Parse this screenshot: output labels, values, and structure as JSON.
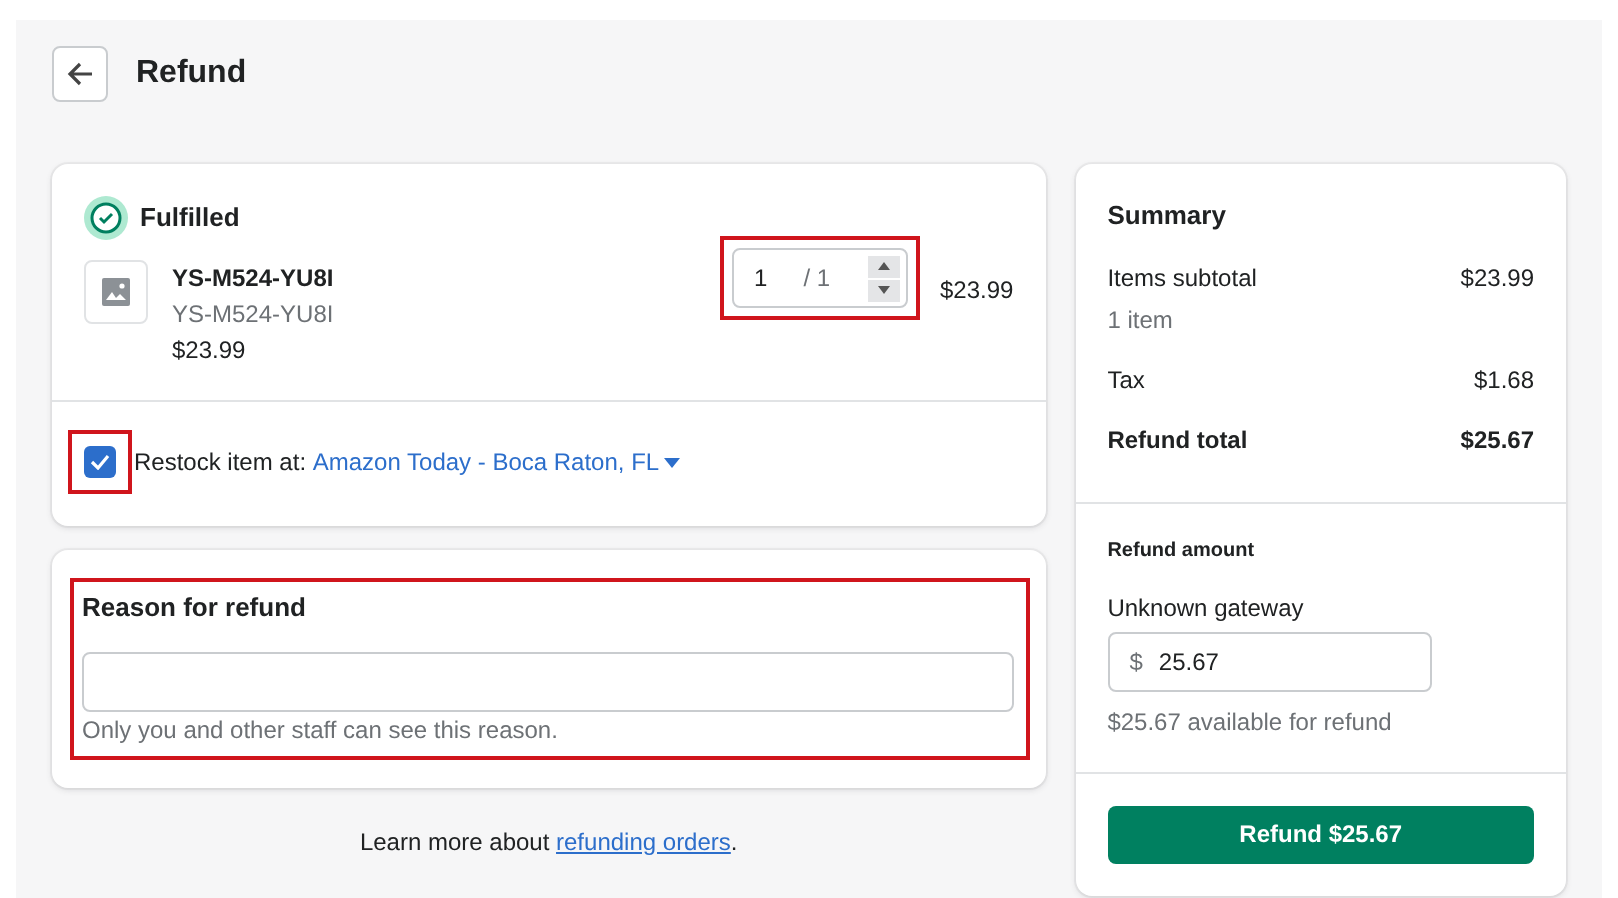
{
  "header": {
    "title": "Refund"
  },
  "fulfillment": {
    "status": "Fulfilled",
    "item": {
      "title": "YS-M524-YU8I",
      "sku": "YS-M524-YU8I",
      "price": "$23.99",
      "quantity": "1",
      "max": "/ 1",
      "total": "$23.99",
      "highlighted": true
    },
    "restock": {
      "checked": true,
      "highlighted": true,
      "label": "Restock item at:",
      "location": "Amazon Today - Boca Raton, FL"
    }
  },
  "reason": {
    "title": "Reason for refund",
    "help": "Only you and other staff can see this reason.",
    "highlighted": true
  },
  "footer": {
    "text": "Learn more about ",
    "link": "refunding orders",
    "end": "."
  },
  "summary": {
    "title": "Summary",
    "lines": [
      {
        "label": "Items subtotal",
        "value": "$23.99",
        "note": "1 item",
        "kind": "line"
      },
      {
        "label": "Tax",
        "value": "$1.68",
        "kind": "line"
      },
      {
        "label": "Refund total",
        "value": "$25.67",
        "kind": "total"
      }
    ],
    "refund_amount": {
      "title": "Refund amount",
      "gateway": "Unknown gateway",
      "currency": "$",
      "value": "25.67",
      "available": "$25.67 available for refund"
    },
    "button": "Refund $25.67"
  }
}
